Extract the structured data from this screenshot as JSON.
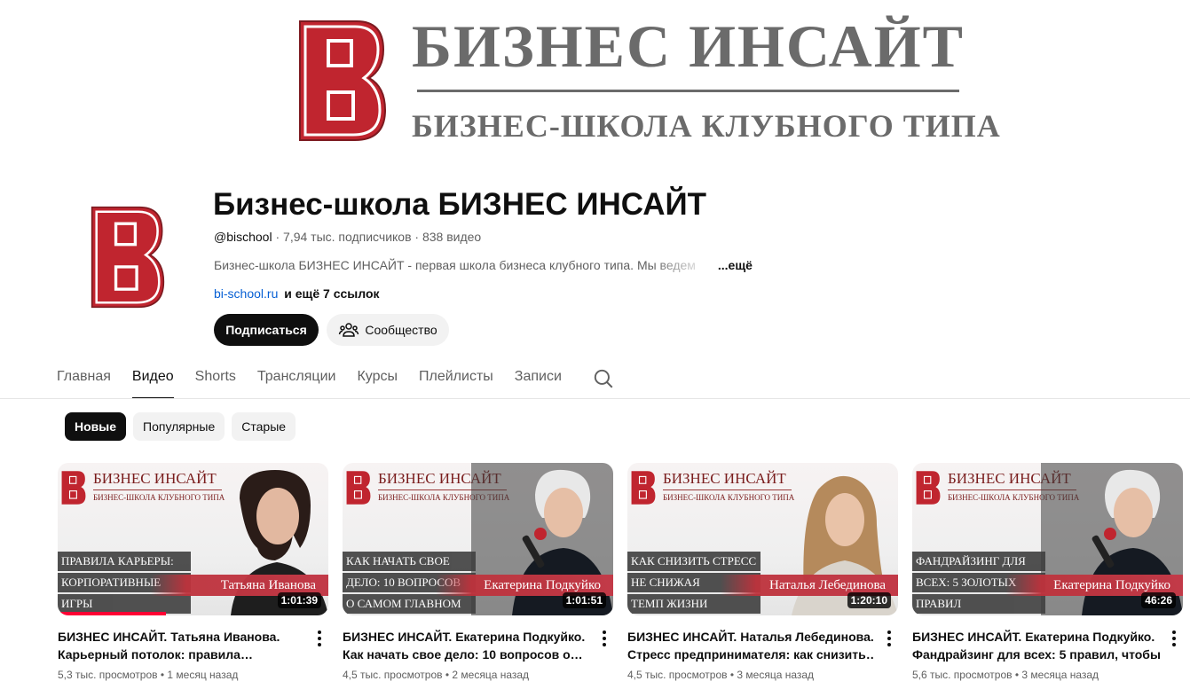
{
  "banner": {
    "title": "БИЗНЕС ИНСАЙТ",
    "subtitle": "БИЗНЕС-ШКОЛА КЛУБНОГО ТИПА"
  },
  "channel": {
    "name": "Бизнес-школа БИЗНЕС ИНСАЙТ",
    "handle": "@bischool",
    "subscribers": "7,94 тыс. подписчиков",
    "video_count": "838 видео",
    "separator": "·",
    "description": "Бизнес-школа БИЗНЕС ИНСАЙТ - первая школа бизнеса клубного типа. Мы ведем",
    "more_label": "...ещё",
    "link": "bi-school.ru",
    "more_links": "и ещё 7 ссылок",
    "subscribe_label": "Подписаться",
    "community_label": "Сообщество"
  },
  "tabs": [
    {
      "label": "Главная",
      "active": false
    },
    {
      "label": "Видео",
      "active": true
    },
    {
      "label": "Shorts",
      "active": false
    },
    {
      "label": "Трансляции",
      "active": false
    },
    {
      "label": "Курсы",
      "active": false
    },
    {
      "label": "Плейлисты",
      "active": false
    },
    {
      "label": "Записи",
      "active": false
    }
  ],
  "chips": [
    {
      "label": "Новые",
      "active": true
    },
    {
      "label": "Популярные",
      "active": false
    },
    {
      "label": "Старые",
      "active": false
    }
  ],
  "thumb_brand": "БИЗНЕС ИНСАЙТ",
  "thumb_sub": "БИЗНЕС-ШКОЛА КЛУБНОГО ТИПА",
  "videos": [
    {
      "title_line1": "БИЗНЕС ИНСАЙТ. Татьяна Иванова.",
      "title_line2": "Карьерный потолок: правила…",
      "views": "5,3 тыс. просмотров",
      "age": "1 месяц назад",
      "duration": "1:01:39",
      "thumb_lines": [
        "ПРАВИЛА КАРЬЕРЫ:",
        "КОРПОРАТИВНЫЕ",
        "ИГРЫ"
      ],
      "thumb_name": "Татьяна Иванова",
      "progress": 0.4
    },
    {
      "title_line1": "БИЗНЕС ИНСАЙТ. Екатерина Подкуйко.",
      "title_line2": "Как начать свое дело: 10 вопросов о…",
      "views": "4,5 тыс. просмотров",
      "age": "2 месяца назад",
      "duration": "1:01:51",
      "thumb_lines": [
        "КАК НАЧАТЬ СВОЕ",
        "ДЕЛО: 10 ВОПРОСОВ",
        "О САМОМ ГЛАВНОМ"
      ],
      "thumb_name": "Екатерина Подкуйко",
      "progress": 0
    },
    {
      "title_line1": "БИЗНЕС ИНСАЙТ. Наталья Лебединова.",
      "title_line2": "Стресс предпринимателя: как снизить…",
      "views": "4,5 тыс. просмотров",
      "age": "3 месяца назад",
      "duration": "1:20:10",
      "thumb_lines": [
        "КАК СНИЗИТЬ СТРЕСС",
        "НЕ СНИЖАЯ",
        "ТЕМП ЖИЗНИ"
      ],
      "thumb_name": "Наталья Лебединова",
      "progress": 0
    },
    {
      "title_line1": "БИЗНЕС ИНСАЙТ. Екатерина Подкуйко.",
      "title_line2": "Фандрайзинг для всех: 5 правил, чтобы…",
      "views": "5,6 тыс. просмотров",
      "age": "3 месяца назад",
      "duration": "46:26",
      "thumb_lines": [
        "ФАНДРАЙЗИНГ ДЛЯ",
        "ВСЕХ: 5 ЗОЛОТЫХ",
        "ПРАВИЛ"
      ],
      "thumb_name": "Екатерина Подкуйко",
      "progress": 0
    }
  ],
  "colors": {
    "brand_red": "#c0252f",
    "banner_gray": "#6b6b6b",
    "link_blue": "#065fd4",
    "progress_red": "#ff0033"
  }
}
